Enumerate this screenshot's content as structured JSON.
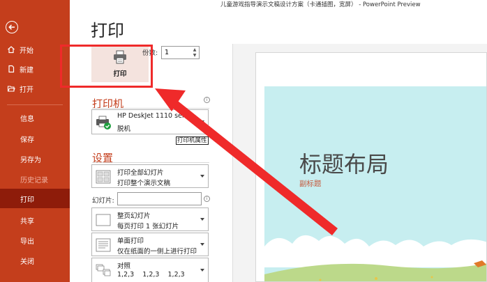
{
  "window": {
    "title": "儿童游戏指导演示文稿设计方案（卡通插图，宽屏） - PowerPoint Preview"
  },
  "sidebar": {
    "items": [
      {
        "label": "开始",
        "icon": "home-icon"
      },
      {
        "label": "新建",
        "icon": "new-document-icon"
      },
      {
        "label": "打开",
        "icon": "open-folder-icon"
      },
      {
        "label": "信息"
      },
      {
        "label": "保存"
      },
      {
        "label": "另存为"
      },
      {
        "label": "历史记录"
      },
      {
        "label": "打印"
      },
      {
        "label": "共享"
      },
      {
        "label": "导出"
      },
      {
        "label": "关闭"
      }
    ]
  },
  "page": {
    "title": "打印"
  },
  "print": {
    "button_label": "打印",
    "copies_label": "份数:",
    "copies_value": "1"
  },
  "printer": {
    "section_title": "打印机",
    "name": "HP DeskJet 1110 seri",
    "status": "脱机",
    "properties_link": "打印机属性"
  },
  "settings": {
    "section_title": "设置",
    "range": {
      "line1": "打印全部幻灯片",
      "line2": "打印整个演示文稿"
    },
    "slides_label": "幻灯片:",
    "slides_value": "",
    "layout": {
      "line1": "整页幻灯片",
      "line2": "每页打印 1 张幻灯片"
    },
    "sides": {
      "line1": "单面打印",
      "line2": "仅在纸面的一侧上进行打印"
    },
    "collate": {
      "line1": "对照",
      "line2": "1,2,3    1,2,3    1,2,3"
    }
  },
  "preview": {
    "slide_title": "标题布局",
    "slide_subtitle": "副标题"
  },
  "colors": {
    "accent": "#c43e1c",
    "active_nav": "#8e1c0a",
    "highlight_box": "#ef2a2a"
  }
}
